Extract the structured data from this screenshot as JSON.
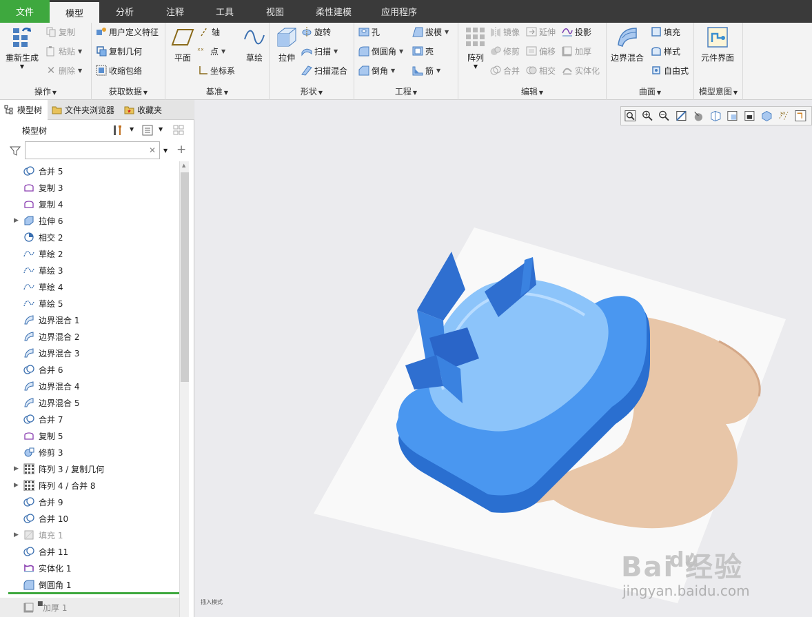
{
  "menu": {
    "tabs": [
      "文件",
      "模型",
      "分析",
      "注释",
      "工具",
      "视图",
      "柔性建模",
      "应用程序"
    ],
    "active": "模型"
  },
  "ribbon": {
    "operations": {
      "label": "操作",
      "regenerate": "重新生成",
      "copy": "复制",
      "paste": "粘贴",
      "delete": "删除"
    },
    "get_data": {
      "label": "获取数据",
      "udf": "用户定义特征",
      "copy_geom": "复制几何",
      "shrinkwrap": "收缩包络"
    },
    "datum": {
      "label": "基准",
      "plane": "平面",
      "axis": "轴",
      "point": "点",
      "csys": "坐标系",
      "sketch": "草绘"
    },
    "shapes": {
      "label": "形状",
      "extrude": "拉伸",
      "revolve": "旋转",
      "sweep": "扫描",
      "swept_blend": "扫描混合"
    },
    "engineering": {
      "label": "工程",
      "hole": "孔",
      "round": "倒圆角",
      "chamfer": "倒角",
      "draft": "拔模",
      "shell": "壳",
      "rib": "筋"
    },
    "editing": {
      "label": "编辑",
      "pattern": "阵列",
      "mirror": "镜像",
      "trim": "修剪",
      "merge": "合并",
      "extend": "延伸",
      "offset": "偏移",
      "intersect": "相交",
      "project": "投影",
      "thicken": "加厚",
      "solidify": "实体化"
    },
    "surfaces": {
      "label": "曲面",
      "boundary_blend": "边界混合",
      "fill": "填充",
      "style": "样式",
      "freestyle": "自由式"
    },
    "model_intent": {
      "label": "模型意图",
      "component_interface": "元件界面"
    }
  },
  "panel": {
    "tabs": [
      "模型树",
      "文件夹浏览器",
      "收藏夹"
    ],
    "tree_title": "模型树",
    "filter_placeholder": "",
    "nodes": [
      {
        "label": "合并 5",
        "icon": "merge-icon",
        "expandable": false
      },
      {
        "label": "复制 3",
        "icon": "copy-surface-icon",
        "expandable": false
      },
      {
        "label": "复制 4",
        "icon": "copy-surface-icon",
        "expandable": false
      },
      {
        "label": "拉伸 6",
        "icon": "extrude-icon",
        "expandable": true
      },
      {
        "label": "相交 2",
        "icon": "intersect-icon",
        "expandable": false
      },
      {
        "label": "草绘 2",
        "icon": "sketch-icon",
        "expandable": false
      },
      {
        "label": "草绘 3",
        "icon": "sketch-icon",
        "expandable": false
      },
      {
        "label": "草绘 4",
        "icon": "sketch-icon",
        "expandable": false
      },
      {
        "label": "草绘 5",
        "icon": "sketch-icon",
        "expandable": false
      },
      {
        "label": "边界混合 1",
        "icon": "boundary-blend-icon",
        "expandable": false
      },
      {
        "label": "边界混合 2",
        "icon": "boundary-blend-icon",
        "expandable": false
      },
      {
        "label": "边界混合 3",
        "icon": "boundary-blend-icon",
        "expandable": false
      },
      {
        "label": "合并 6",
        "icon": "merge-icon",
        "expandable": false
      },
      {
        "label": "边界混合 4",
        "icon": "boundary-blend-icon",
        "expandable": false
      },
      {
        "label": "边界混合 5",
        "icon": "boundary-blend-icon",
        "expandable": false
      },
      {
        "label": "合并 7",
        "icon": "merge-icon",
        "expandable": false
      },
      {
        "label": "复制 5",
        "icon": "copy-surface-icon",
        "expandable": false
      },
      {
        "label": "修剪 3",
        "icon": "trim-icon",
        "expandable": false
      },
      {
        "label": "阵列 3 / 复制几何",
        "icon": "pattern-icon",
        "expandable": true
      },
      {
        "label": "阵列 4 / 合并 8",
        "icon": "pattern-icon",
        "expandable": true
      },
      {
        "label": "合并 9",
        "icon": "merge-icon",
        "expandable": false
      },
      {
        "label": "合并 10",
        "icon": "merge-icon",
        "expandable": false
      },
      {
        "label": "填充 1",
        "icon": "fill-icon",
        "expandable": true,
        "dim": true
      },
      {
        "label": "合并 11",
        "icon": "merge-icon",
        "expandable": false
      },
      {
        "label": "实体化 1",
        "icon": "solidify-icon",
        "expandable": false
      },
      {
        "label": "倒圆角 1",
        "icon": "round-icon",
        "expandable": false
      }
    ],
    "bottom_node": "加厚 1"
  },
  "viewport": {
    "status": "插入模式",
    "watermark_brand": "Bai  经验",
    "watermark_du": "du",
    "watermark_url": "jingyan.baidu.com"
  },
  "colors": {
    "accent": "#3ea83e",
    "model_blue": "#3b87e8",
    "menubar": "#3a3a3a"
  }
}
